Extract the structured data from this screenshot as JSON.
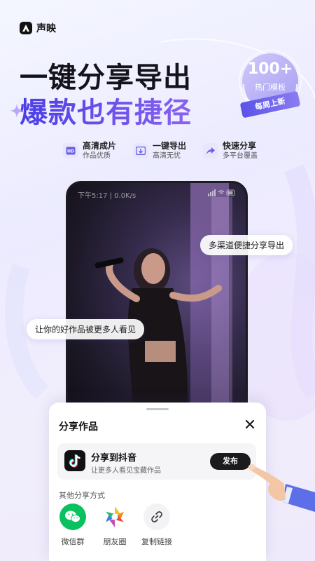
{
  "brand": {
    "name": "声映"
  },
  "hero": {
    "headline": "一键分享导出",
    "subline": "爆款也有捷径"
  },
  "badge": {
    "count": "100+",
    "label": "热门模板",
    "ribbon": "每周上新"
  },
  "features": [
    {
      "icon": "hd-icon",
      "title": "高清成片",
      "subtitle": "作品优质"
    },
    {
      "icon": "export-icon",
      "title": "一键导出",
      "subtitle": "高清无忧"
    },
    {
      "icon": "share-arrow-icon",
      "title": "快速分享",
      "subtitle": "多平台覆盖"
    }
  ],
  "phone": {
    "status_left": "下午5:17 | 0.0K/s"
  },
  "bubbles": {
    "channels": "多渠道便捷分享导出",
    "reach": "让你的好作品被更多人看见"
  },
  "sheet": {
    "title": "分享作品",
    "douyin": {
      "title": "分享到抖音",
      "subtitle": "让更多人看见宝藏作品",
      "button": "发布"
    },
    "other_title": "其他分享方式",
    "options": [
      {
        "icon": "wechat-icon",
        "label": "微信群",
        "color": "#09c25f"
      },
      {
        "icon": "moments-icon",
        "label": "朋友圈",
        "color": "#ffffff"
      },
      {
        "icon": "link-icon",
        "label": "复制链接",
        "color": "#f3f3f5"
      }
    ]
  },
  "colors": {
    "accent": "#5b4ee9",
    "accent_light": "#8a62f0",
    "dark_button": "#1b1b1f",
    "wechat": "#09c25f"
  }
}
